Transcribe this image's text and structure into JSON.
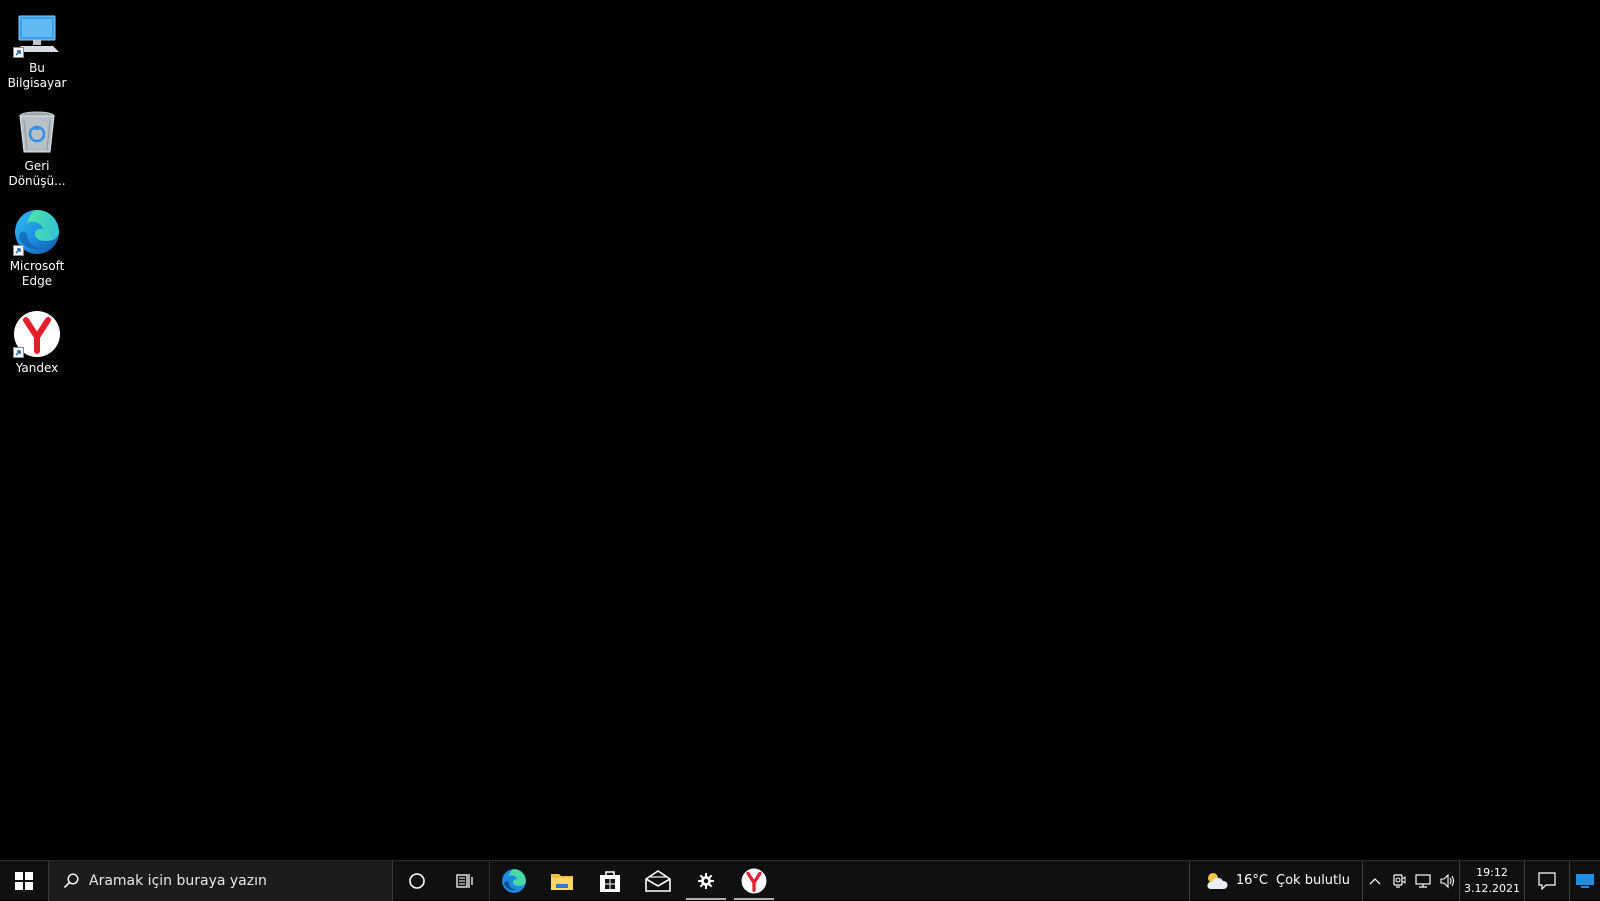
{
  "desktop": {
    "icons": [
      {
        "label": "Bu Bilgisayar",
        "icon": "computer-icon"
      },
      {
        "label": "Geri\nDönüşü...",
        "icon": "recycle-bin-icon"
      },
      {
        "label": "Microsoft\nEdge",
        "icon": "edge-icon"
      },
      {
        "label": "Yandex",
        "icon": "yandex-icon"
      }
    ]
  },
  "taskbar": {
    "search_placeholder": "Aramak için buraya yazın",
    "pinned": [
      "edge-icon",
      "file-explorer-icon",
      "store-icon",
      "mail-icon",
      "settings-icon",
      "yandex-icon"
    ],
    "active_apps": [
      "settings",
      "yandex"
    ],
    "weather": {
      "temperature": "16°C",
      "condition": "Çok bulutlu"
    },
    "clock": {
      "time": "19:12",
      "date": "3.12.2021"
    }
  },
  "colors": {
    "desktop_bg": "#000000",
    "taskbar_bg": "#101010",
    "accent": "#0078d7"
  }
}
